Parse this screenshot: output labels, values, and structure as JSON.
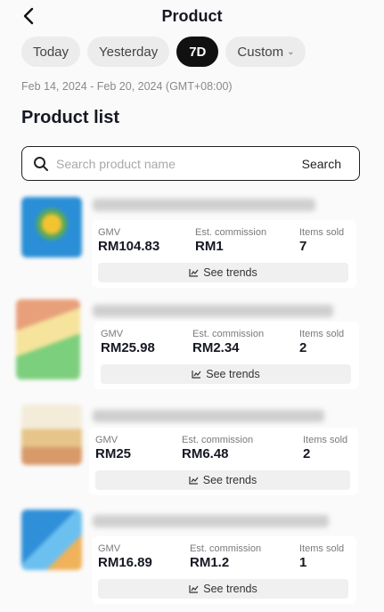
{
  "header": {
    "title": "Product"
  },
  "tabs": [
    {
      "label": "Today"
    },
    {
      "label": "Yesterday"
    },
    {
      "label": "7D"
    },
    {
      "label": "Custom"
    }
  ],
  "date_range": "Feb 14, 2024 - Feb 20, 2024 (GMT+08:00)",
  "section_title": "Product list",
  "search": {
    "placeholder": "Search product name",
    "button_label": "Search"
  },
  "stat_labels": {
    "gmv": "GMV",
    "commission": "Est. commission",
    "items_sold": "Items sold"
  },
  "trend_label": "See trends",
  "products": [
    {
      "gmv": "RM104.83",
      "commission": "RM1",
      "items_sold": "7"
    },
    {
      "gmv": "RM25.98",
      "commission": "RM2.34",
      "items_sold": "2"
    },
    {
      "gmv": "RM25",
      "commission": "RM6.48",
      "items_sold": "2"
    },
    {
      "gmv": "RM16.89",
      "commission": "RM1.2",
      "items_sold": "1"
    }
  ]
}
